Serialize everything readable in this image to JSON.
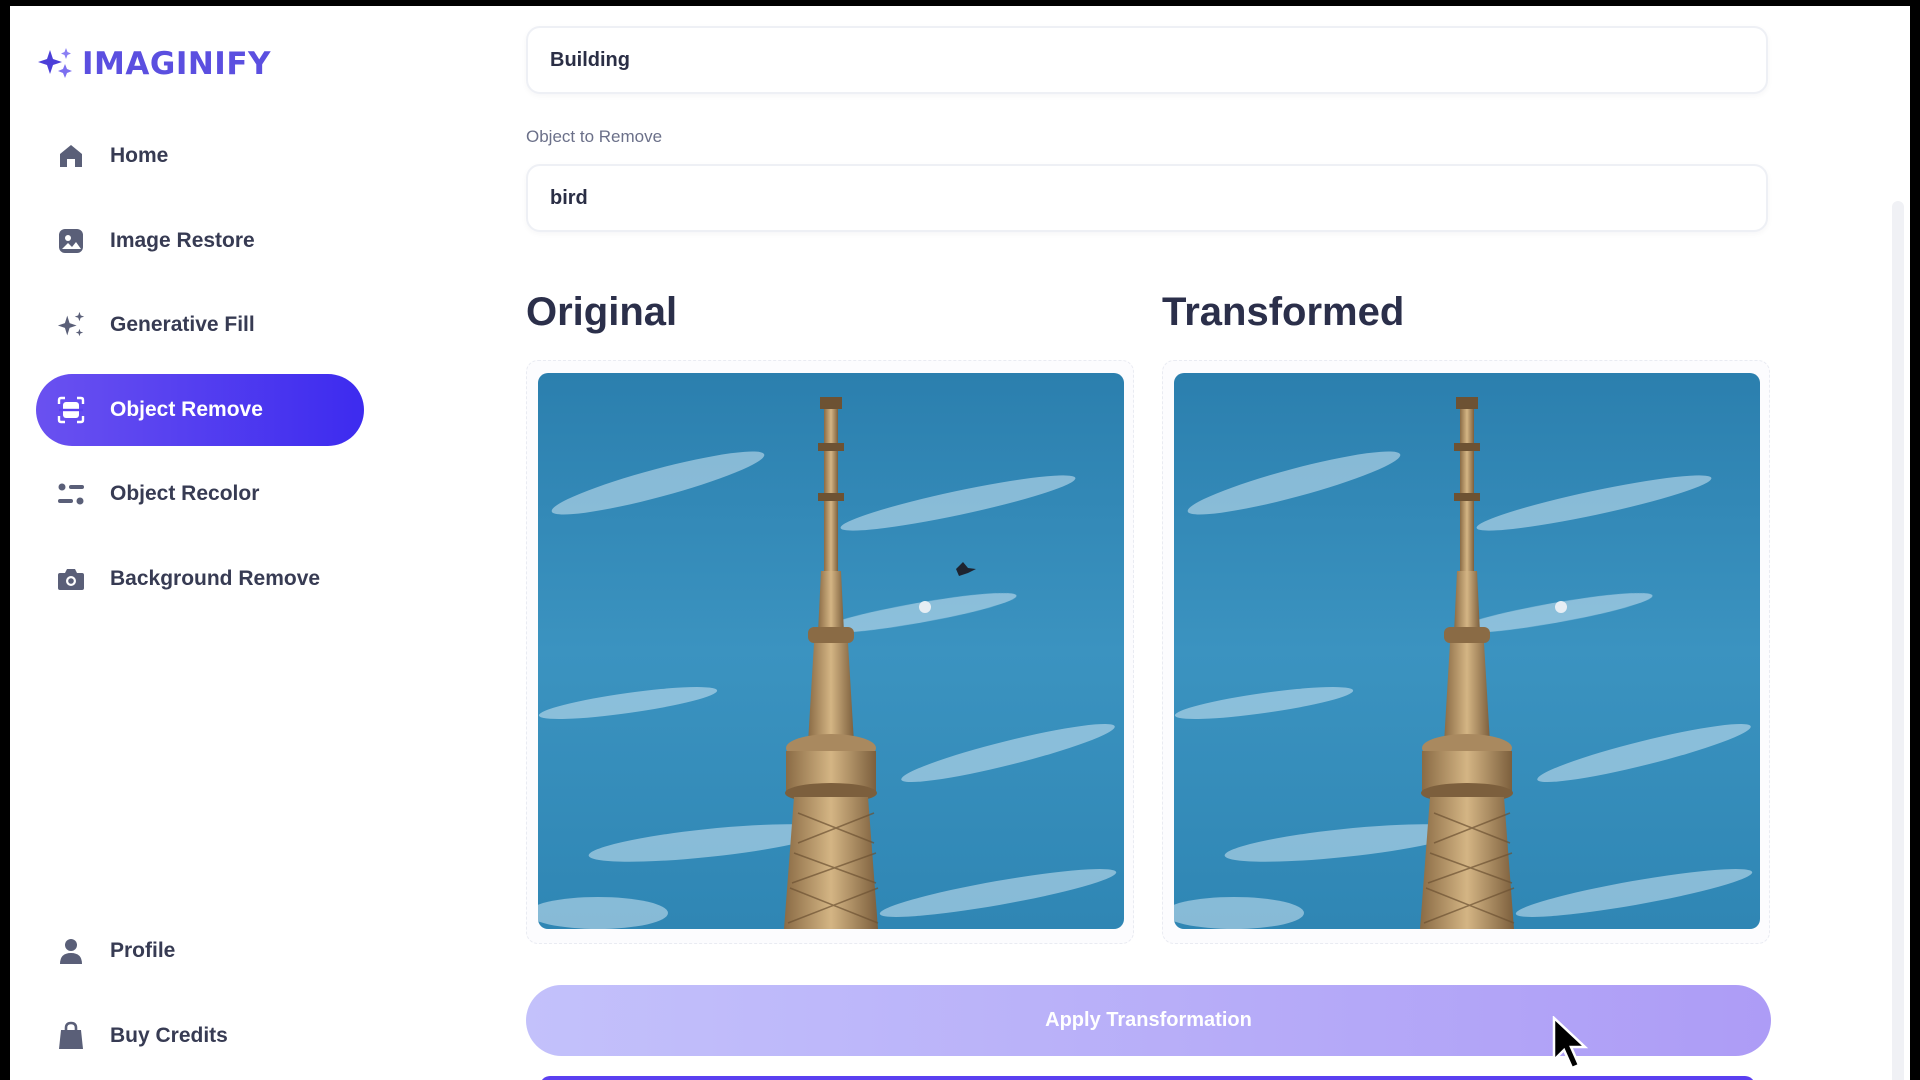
{
  "app": {
    "name": "IMAGINIFY",
    "brand_color": "#5b4fe0",
    "accent_gradient": [
      "#6a51f0",
      "#3d2bef"
    ]
  },
  "sidebar": {
    "items": [
      {
        "label": "Home",
        "icon": "home-icon",
        "active": false
      },
      {
        "label": "Image Restore",
        "icon": "image-icon",
        "active": false
      },
      {
        "label": "Generative Fill",
        "icon": "sparkles-icon",
        "active": false
      },
      {
        "label": "Object Remove",
        "icon": "scan-icon",
        "active": true
      },
      {
        "label": "Object Recolor",
        "icon": "filter-icon",
        "active": false
      },
      {
        "label": "Background Remove",
        "icon": "camera-icon",
        "active": false
      }
    ],
    "bottom_items": [
      {
        "label": "Profile",
        "icon": "user-icon"
      },
      {
        "label": "Buy Credits",
        "icon": "bag-icon"
      }
    ]
  },
  "form": {
    "title_value": "Building",
    "object_label": "Object to Remove",
    "object_value": "bird"
  },
  "preview": {
    "original_heading": "Original",
    "transformed_heading": "Transformed"
  },
  "actions": {
    "apply_label": "Apply Transformation"
  }
}
